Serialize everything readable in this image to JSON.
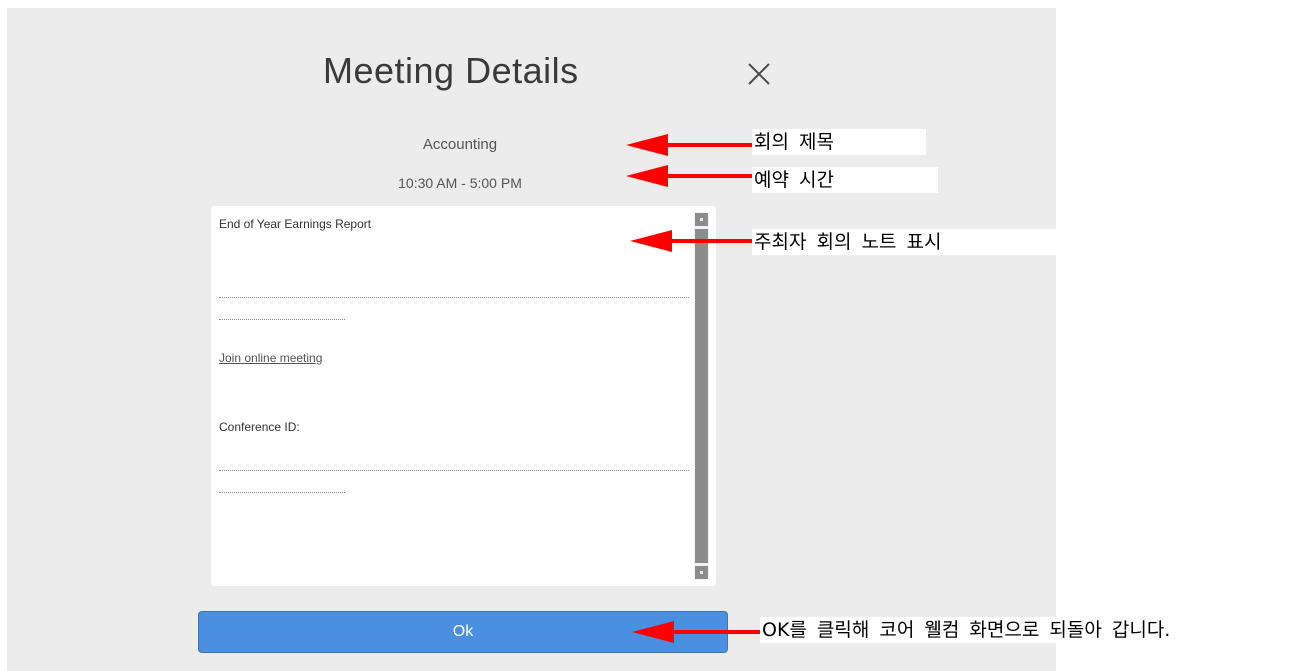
{
  "dialog": {
    "title": "Meeting Details",
    "close_icon": "close-icon",
    "meeting": {
      "subject": "Accounting",
      "time": "10:30 AM - 5:00 PM"
    },
    "notes": {
      "heading": "End of Year Earnings Report",
      "join_link": "Join online meeting",
      "conference_label": "Conference ID:"
    },
    "ok_label": "Ok"
  },
  "annotations": {
    "subject_label": "회의 제목",
    "time_label": "예약 시간",
    "notes_label": "주최자 회의 노트 표시",
    "ok_label": "OK를 클릭해 코어 웰컴 화면으로 되돌아 갑니다."
  },
  "colors": {
    "dialog_bg": "#ececec",
    "accent_button": "#4a8fe0",
    "annotation_arrow": "#ff0000",
    "scrollbar": "#8c8c8c"
  }
}
